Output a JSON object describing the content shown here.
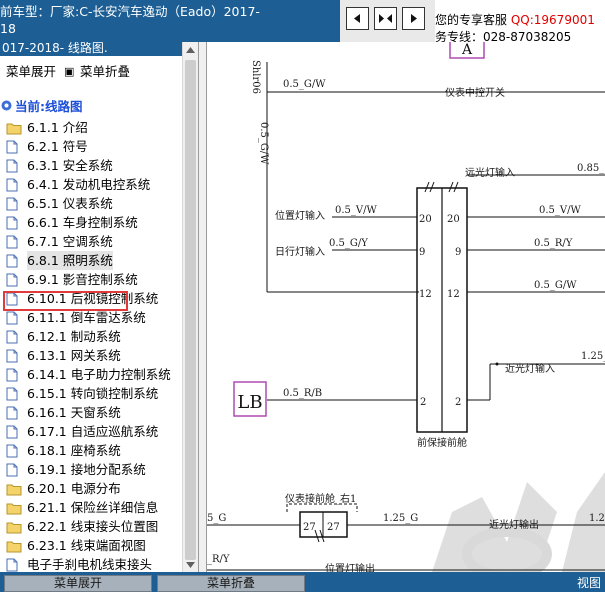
{
  "header": {
    "title_line1": "前车型：厂家:C-长安汽车逸动（Eado）2017-",
    "title_line2": "18",
    "contact_label": "您的专享客服",
    "qq": "QQ:19679001",
    "hotline": "务专线：028-87038205"
  },
  "nav_buttons": [
    {
      "icon": "arrow-left-box-icon"
    },
    {
      "icon": "arrows-inward-icon"
    },
    {
      "icon": "arrow-right-box-icon"
    }
  ],
  "left_panel": {
    "header_text": "017-2018- 线路图.",
    "expand_label": "菜单展开",
    "collapse_label": "菜单折叠",
    "root_label": "当前:线路图",
    "items": [
      {
        "label": "6.1.1 介绍",
        "icon": "folder"
      },
      {
        "label": "6.2.1 符号",
        "icon": "document"
      },
      {
        "label": "6.3.1 安全系统",
        "icon": "document"
      },
      {
        "label": "6.4.1 发动机电控系统",
        "icon": "document"
      },
      {
        "label": "6.5.1 仪表系统",
        "icon": "document"
      },
      {
        "label": "6.6.1 车身控制系统",
        "icon": "document"
      },
      {
        "label": "6.7.1 空调系统",
        "icon": "document"
      },
      {
        "label": "6.8.1 照明系统",
        "icon": "document",
        "selected": true
      },
      {
        "label": "6.9.1 影音控制系统",
        "icon": "document"
      },
      {
        "label": "6.10.1 后视镜控制系统",
        "icon": "document"
      },
      {
        "label": "6.11.1 倒车雷达系统",
        "icon": "document"
      },
      {
        "label": "6.12.1 制动系统",
        "icon": "document"
      },
      {
        "label": "6.13.1 网关系统",
        "icon": "document"
      },
      {
        "label": "6.14.1 电子助力控制系统",
        "icon": "document"
      },
      {
        "label": "6.15.1 转向锁控制系统",
        "icon": "document"
      },
      {
        "label": "6.16.1 天窗系统",
        "icon": "document"
      },
      {
        "label": "6.17.1 自适应巡航系统",
        "icon": "document"
      },
      {
        "label": "6.18.1 座椅系统",
        "icon": "document"
      },
      {
        "label": "6.19.1 接地分配系统",
        "icon": "document"
      },
      {
        "label": "6.20.1 电源分布",
        "icon": "folder"
      },
      {
        "label": "6.21.1 保险丝详细信息",
        "icon": "folder"
      },
      {
        "label": "6.22.1 线束接头位置图",
        "icon": "folder"
      },
      {
        "label": "6.23.1 线束端面视图",
        "icon": "folder"
      },
      {
        "label": "电子手刹电机线束接头",
        "icon": "document"
      }
    ]
  },
  "diagram": {
    "conn_label_top": "Shlr06",
    "wire_vertical": "0.5_G/W",
    "wire_top": "0.5_G/W",
    "label_top": "仪表中控开关",
    "label_high_beam": "远光灯输入",
    "wire_high_beam": "0.85_",
    "label_position": "位置灯输入",
    "wire_pos_left": "0.5_V/W",
    "wire_pos_right": "0.5_V/W",
    "pin_20": "20",
    "label_drl": "日行灯输入",
    "wire_drl_left": "0.5_G/Y",
    "wire_drl_right": "0.5_R/Y",
    "pin_9": "9",
    "pin_12": "12",
    "wire_12_right": "0.5_G/W",
    "label_low_beam": "近光灯输入",
    "wire_low_beam": "1.25_",
    "lb_label": "LB",
    "wire_lb": "0.5_R/B",
    "pin_2": "2",
    "conn_name": "前保接前舱",
    "conn2_name": "仪表接前舱_右1",
    "pin_27": "27",
    "wire_27_left": "5_G",
    "wire_27_right": "1.25_G",
    "label_low_out": "近光灯输出",
    "wire_low_out_right": "1.2",
    "wire_bottom_left": "_R/Y",
    "label_pos_out": "位置灯输出",
    "top_box_label": "A"
  },
  "bottom_bar": {
    "expand_label": "菜单展开",
    "collapse_label": "菜单折叠",
    "view_label": "视图"
  },
  "colors": {
    "title_bar": "#1d5f94",
    "qq_red": "#e00000",
    "selection_box": "#e03a3a",
    "lb_box": "#b04ab0",
    "tree_root": "#1d4fd8"
  }
}
